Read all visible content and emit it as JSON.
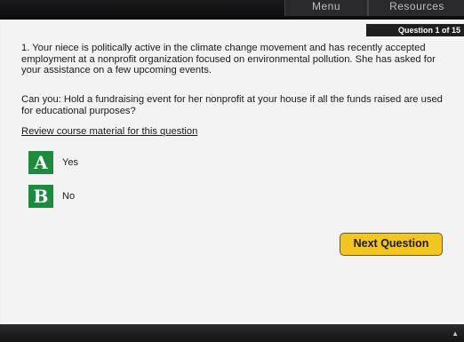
{
  "nav": {
    "menu_label": "Menu",
    "resources_label": "Resources"
  },
  "question": {
    "counter": "Question 1 of 15",
    "number": "1.",
    "text": "1. Your niece is politically active in the climate change movement and has recently accepted employment at a nonprofit organization focused on environmental pollution. She has asked for your assistance on a few upcoming events.",
    "prompt": "Can you: Hold a fundraising event for her nonprofit at your house if all the funds raised are used for educational purposes?",
    "review_link": "Review course material for this question"
  },
  "answers": [
    {
      "letter": "A",
      "label": "Yes"
    },
    {
      "letter": "B",
      "label": "No"
    }
  ],
  "next_button": "Next Question",
  "colors": {
    "answer_box": "#1e8a3e",
    "next_button": "#f2c521",
    "header_bar": "#1e1e1e"
  },
  "icons": {
    "corner": "arrow-icon"
  }
}
